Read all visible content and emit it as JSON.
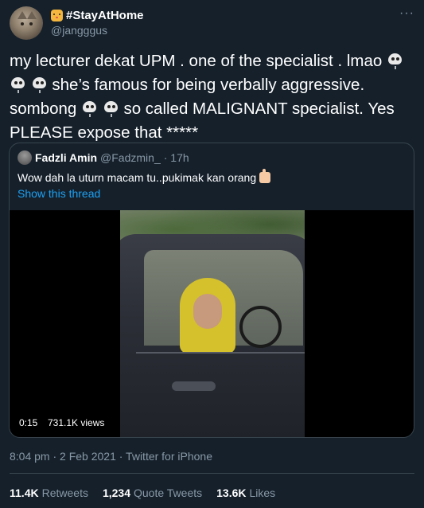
{
  "tweet": {
    "display_name": "#StayAtHome",
    "handle": "@jangggus",
    "text_line1": "my lecturer dekat UPM . one of the specialist . lmao",
    "text_line2": "she’s famous for being verbally aggressive.",
    "text_line3a": "sombong",
    "text_line3b": "so called MALIGNANT specialist. Yes",
    "text_line4": "PLEASE expose that *****",
    "timestamp": "8:04 pm · 2 Feb 2021 · Twitter for iPhone"
  },
  "quoted": {
    "name": "Fadzli Amin",
    "handle": "@Fadzmin_",
    "time": "· 17h",
    "text": "Wow dah la uturn macam tu..pukimak kan orang",
    "thread_link": "Show this thread",
    "video_time": "0:15",
    "video_views": "731.1K views"
  },
  "stats": {
    "retweets_num": "11.4K",
    "retweets_label": "Retweets",
    "quotes_num": "1,234",
    "quotes_label": "Quote Tweets",
    "likes_num": "13.6K",
    "likes_label": "Likes"
  },
  "icons": [
    "tiger-icon",
    "more-icon",
    "skull-icon",
    "thumbs-up-icon"
  ]
}
